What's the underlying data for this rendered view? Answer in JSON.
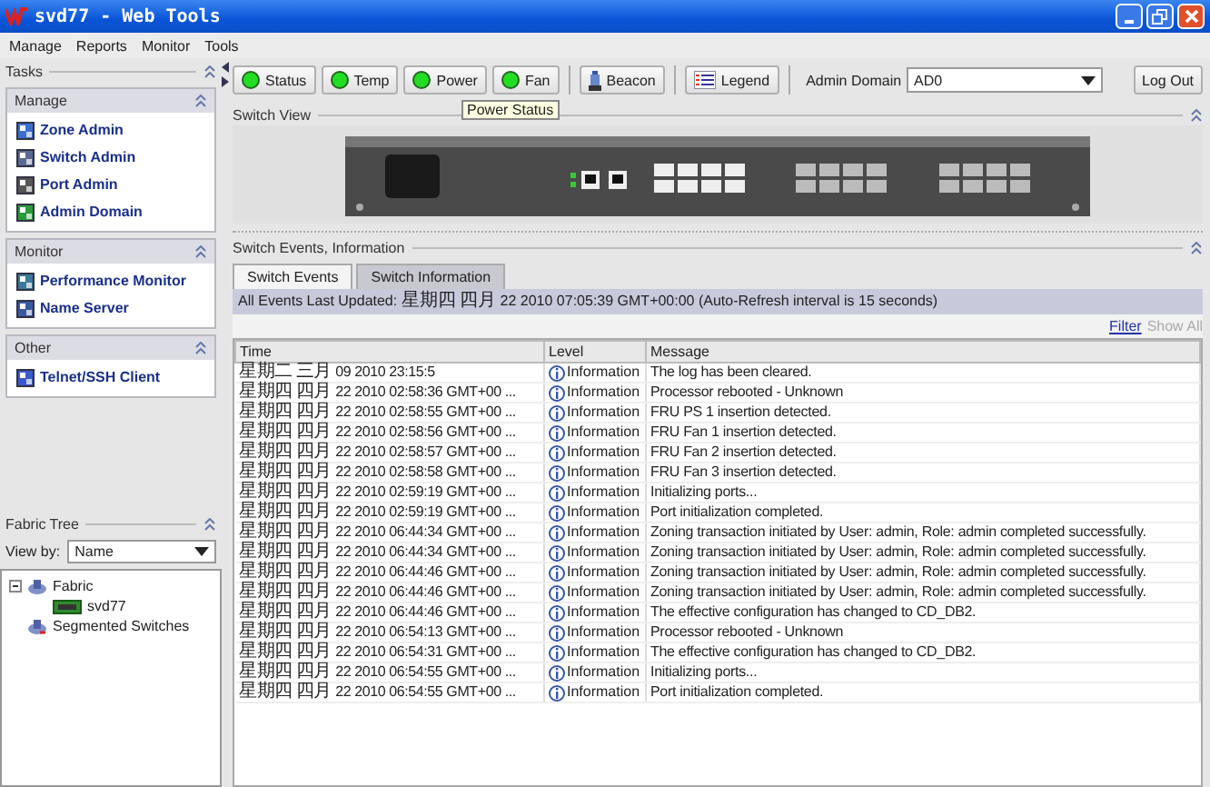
{
  "window": {
    "title": "svd77 - Web Tools"
  },
  "menu": [
    "Manage",
    "Reports",
    "Monitor",
    "Tools"
  ],
  "tasks": {
    "title": "Tasks",
    "groups": [
      {
        "title": "Manage",
        "items": [
          {
            "label": "Zone Admin"
          },
          {
            "label": "Switch Admin"
          },
          {
            "label": "Port Admin"
          },
          {
            "label": "Admin Domain"
          }
        ]
      },
      {
        "title": "Monitor",
        "items": [
          {
            "label": "Performance Monitor"
          },
          {
            "label": "Name Server"
          }
        ]
      },
      {
        "title": "Other",
        "items": [
          {
            "label": "Telnet/SSH Client"
          }
        ]
      }
    ]
  },
  "fabric_tree": {
    "title": "Fabric Tree",
    "view_by_label": "View by:",
    "view_by_value": "Name",
    "nodes": [
      {
        "label": "Fabric",
        "expanded": true,
        "children": [
          {
            "label": "svd77"
          }
        ]
      },
      {
        "label": "Segmented Switches"
      }
    ]
  },
  "toolbar": {
    "status_buttons": [
      {
        "label": "Status",
        "color": "#22dd22"
      },
      {
        "label": "Temp",
        "color": "#22dd22"
      },
      {
        "label": "Power",
        "color": "#22dd22"
      },
      {
        "label": "Fan",
        "color": "#22dd22"
      }
    ],
    "beacon": "Beacon",
    "legend": "Legend",
    "admin_domain_label": "Admin Domain",
    "admin_domain_value": "AD0",
    "logout": "Log Out",
    "tooltip": "Power Status"
  },
  "switch_view": {
    "title": "Switch View"
  },
  "events": {
    "title": "Switch Events, Information",
    "tabs": [
      {
        "label": "Switch Events",
        "selected": true
      },
      {
        "label": "Switch Information",
        "selected": false
      }
    ],
    "info_bar": "All Events  Last Updated: 星期四 四月 22 2010 07:05:39 GMT+00:00  (Auto-Refresh interval is 15 seconds)",
    "filter": {
      "label": "Filter",
      "disabled": false
    },
    "show_all": {
      "label": "Show All",
      "disabled": true
    },
    "columns": [
      "Time",
      "Level",
      "Message"
    ],
    "rows": [
      {
        "time": "星期二 三月 09 2010 23:15:5",
        "level": "Information",
        "message": "The log has been cleared."
      },
      {
        "time": "星期四 四月 22 2010 02:58:36 GMT+00 ...",
        "level": "Information",
        "message": "Processor rebooted - Unknown"
      },
      {
        "time": "星期四 四月 22 2010 02:58:55 GMT+00 ...",
        "level": "Information",
        "message": "FRU PS 1 insertion detected."
      },
      {
        "time": "星期四 四月 22 2010 02:58:56 GMT+00 ...",
        "level": "Information",
        "message": "FRU Fan 1 insertion detected."
      },
      {
        "time": "星期四 四月 22 2010 02:58:57 GMT+00 ...",
        "level": "Information",
        "message": "FRU Fan 2 insertion detected."
      },
      {
        "time": "星期四 四月 22 2010 02:58:58 GMT+00 ...",
        "level": "Information",
        "message": "FRU Fan 3 insertion detected."
      },
      {
        "time": "星期四 四月 22 2010 02:59:19 GMT+00 ...",
        "level": "Information",
        "message": "Initializing ports..."
      },
      {
        "time": "星期四 四月 22 2010 02:59:19 GMT+00 ...",
        "level": "Information",
        "message": "Port initialization completed."
      },
      {
        "time": "星期四 四月 22 2010 06:44:34 GMT+00 ...",
        "level": "Information",
        "message": "Zoning transaction initiated by User: admin, Role: admin completed successfully."
      },
      {
        "time": "星期四 四月 22 2010 06:44:34 GMT+00 ...",
        "level": "Information",
        "message": "Zoning transaction initiated by User: admin, Role: admin completed successfully."
      },
      {
        "time": "星期四 四月 22 2010 06:44:46 GMT+00 ...",
        "level": "Information",
        "message": "Zoning transaction initiated by User: admin, Role: admin completed successfully."
      },
      {
        "time": "星期四 四月 22 2010 06:44:46 GMT+00 ...",
        "level": "Information",
        "message": "Zoning transaction initiated by User: admin, Role: admin completed successfully."
      },
      {
        "time": "星期四 四月 22 2010 06:44:46 GMT+00 ...",
        "level": "Information",
        "message": "The effective configuration has changed to CD_DB2."
      },
      {
        "time": "星期四 四月 22 2010 06:54:13 GMT+00 ...",
        "level": "Information",
        "message": "Processor rebooted - Unknown"
      },
      {
        "time": "星期四 四月 22 2010 06:54:31 GMT+00 ...",
        "level": "Information",
        "message": "The effective configuration has changed to CD_DB2."
      },
      {
        "time": "星期四 四月 22 2010 06:54:55 GMT+00 ...",
        "level": "Information",
        "message": "Initializing ports..."
      },
      {
        "time": "星期四 四月 22 2010 06:54:55 GMT+00 ...",
        "level": "Information",
        "message": "Port initialization completed."
      }
    ]
  }
}
